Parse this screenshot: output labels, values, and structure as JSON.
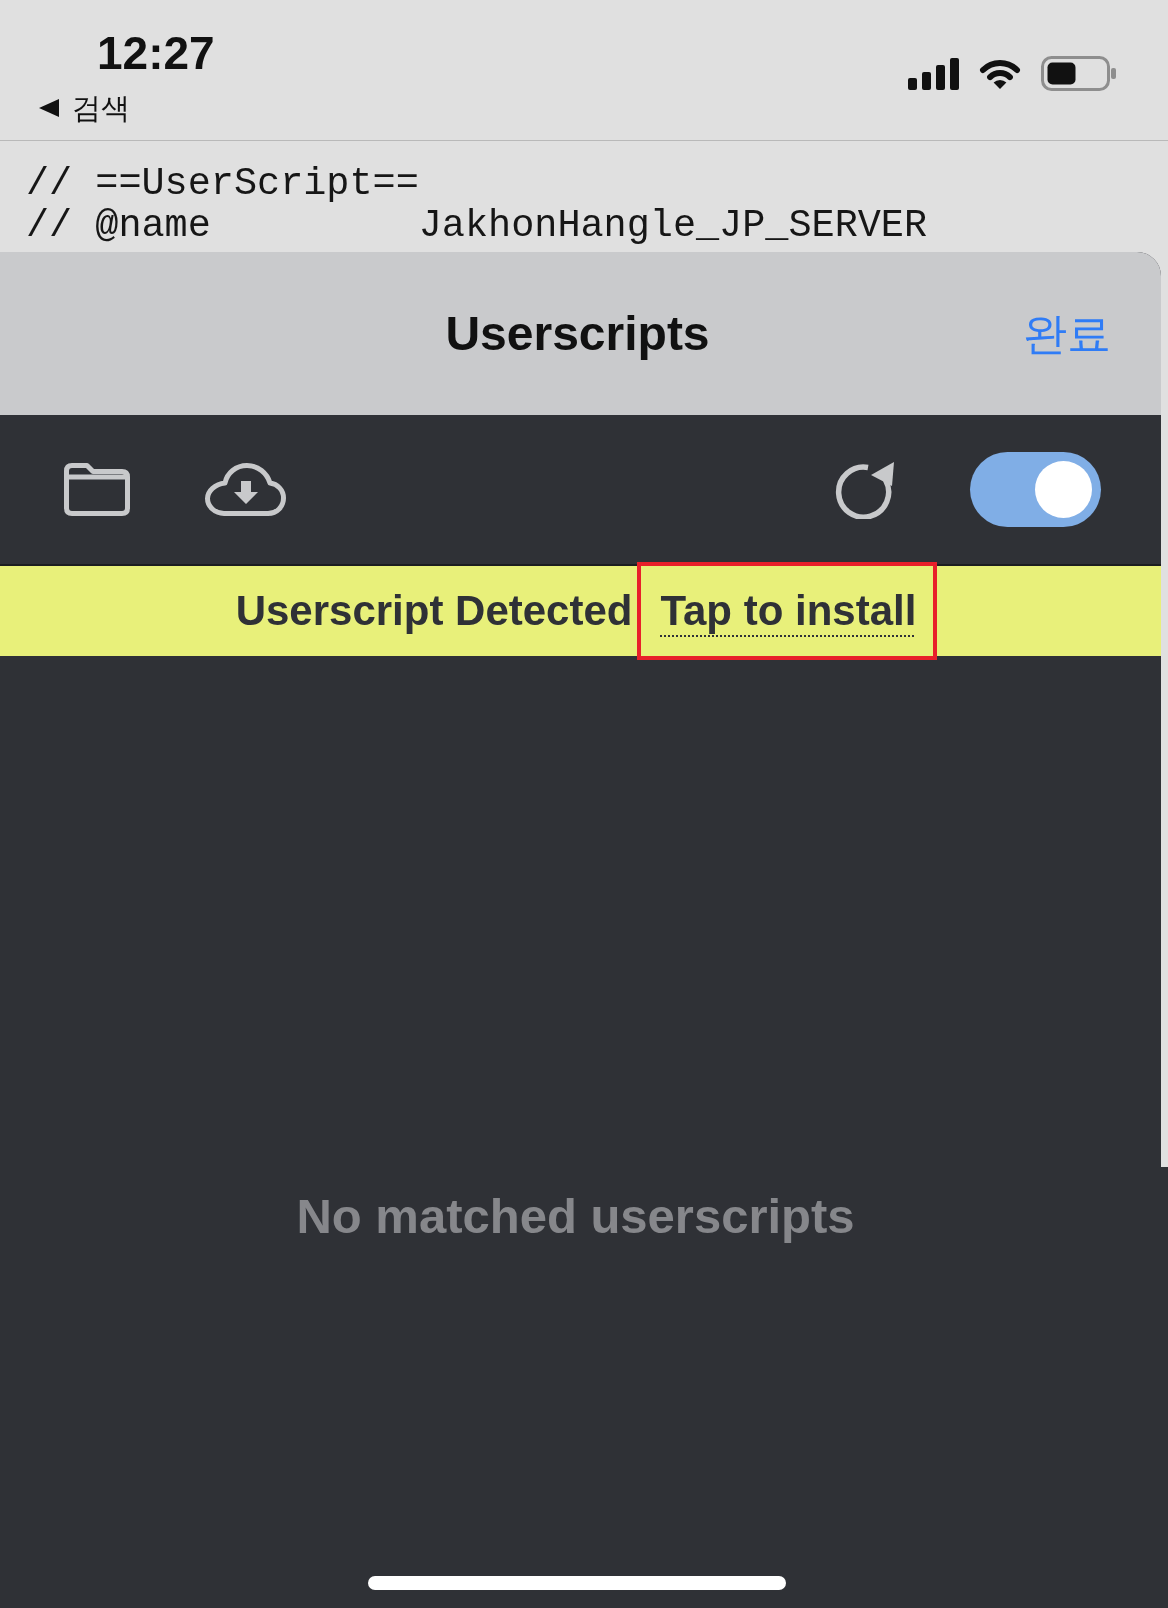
{
  "status_bar": {
    "time": "12:27",
    "back_label": "검색"
  },
  "code_lines": [
    "// ==UserScript==",
    "// @name         JakhonHangle_JP_SERVER"
  ],
  "sheet": {
    "title": "Userscripts",
    "done_label": "완료"
  },
  "toolbar": {
    "toggle": {
      "on": true
    }
  },
  "banner": {
    "message": "Userscript Detected",
    "install_link": {
      "label": "Tap to install",
      "highlighted": true
    }
  },
  "empty_message": "No matched userscripts"
}
